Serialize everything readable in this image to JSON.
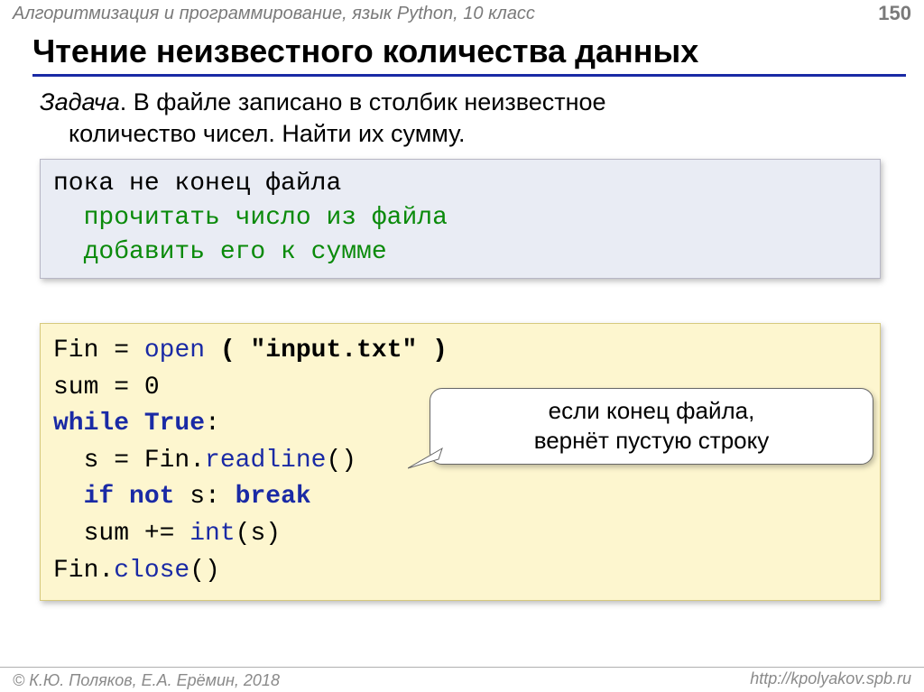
{
  "header": {
    "breadcrumb": "Алгоритмизация и программирование, язык Python, 10 класс",
    "page_number": "150"
  },
  "title": "Чтение неизвестного количества данных",
  "task": {
    "label": "Задача",
    "sep": ". ",
    "line1": "В файле записано в столбик неизвестное",
    "line2": "количество чисел. Найти их сумму."
  },
  "pseudo": {
    "l1": "пока не конец файла",
    "l2": "  прочитать число из файла",
    "l3": "  добавить его к сумме"
  },
  "code": {
    "fin_var": "Fin",
    "eq1": " = ",
    "open": "open",
    "open_args": " ( \"input.txt\" )",
    "sum_var": "sum",
    "eq2": " = ",
    "zero": "0",
    "while_kw": "while",
    "true_kw": " True",
    "colon": ":",
    "indent": "  ",
    "s_assign": "s = Fin.",
    "readline": "readline",
    "paren1": "()",
    "if_kw": "if not",
    "if_rest": " s: ",
    "break_kw": "break",
    "sum_pluseq": "sum += ",
    "int_fn": "int",
    "int_arg": "(s)",
    "close_line_pre": "Fin.",
    "close_fn": "close",
    "paren2": "()"
  },
  "callout": {
    "line1": "если конец файла,",
    "line2": "вернёт пустую строку"
  },
  "footer": {
    "left": "© К.Ю. Поляков, Е.А. Ерёмин, 2018",
    "right": "http://kpolyakov.spb.ru"
  }
}
